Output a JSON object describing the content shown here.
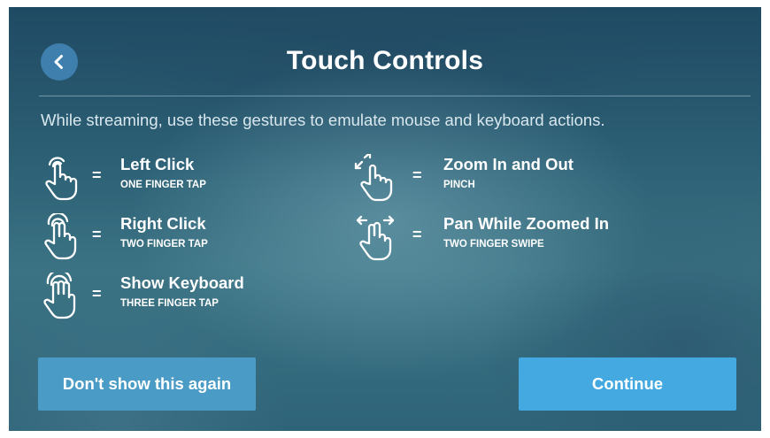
{
  "header": {
    "title": "Touch Controls",
    "back_icon": "chevron-left-icon"
  },
  "intro": "While streaming, use these gestures to emulate mouse and keyboard actions.",
  "equals_sign": "=",
  "gestures": [
    {
      "name": "Left Click",
      "description": "ONE FINGER TAP",
      "icon": "one-finger-tap-icon"
    },
    {
      "name": "Right Click",
      "description": "TWO FINGER TAP",
      "icon": "two-finger-tap-icon"
    },
    {
      "name": "Show Keyboard",
      "description": "THREE FINGER TAP",
      "icon": "three-finger-tap-icon"
    },
    {
      "name": "Zoom In and Out",
      "description": "PINCH",
      "icon": "pinch-icon"
    },
    {
      "name": "Pan While Zoomed In",
      "description": "TWO FINGER SWIPE",
      "icon": "two-finger-swipe-icon"
    }
  ],
  "buttons": {
    "dont_show_again": "Don't show this again",
    "continue": "Continue"
  },
  "colors": {
    "back_button": "#3f7fae",
    "secondary_button": "#4a9cc6",
    "primary_button": "#43a9e0",
    "text": "#ffffff"
  }
}
